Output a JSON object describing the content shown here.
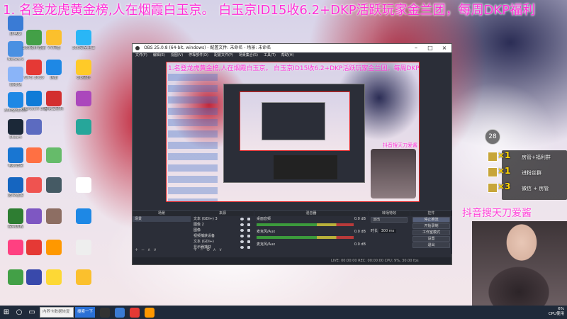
{
  "marquee": "1. 名登龙虎黄金榜,人在烟霞白玉京。 白玉京ID15收6.2+DKP活跃玩家金兰团，每周DKP福利",
  "desktop_icons": [
    {
      "label": "此电脑",
      "color": "#3a7bd5"
    },
    {
      "label": "Network",
      "color": "#4a90e2"
    },
    {
      "label": "回收站",
      "color": "#8ab4f8"
    },
    {
      "label": "360驱动大师",
      "color": "#1e88e5"
    },
    {
      "label": "Steam",
      "color": "#1b2838"
    },
    {
      "label": "电脑管家",
      "color": "#1976d2"
    },
    {
      "label": "宽带连接",
      "color": "#1565c0"
    },
    {
      "label": "控制面板",
      "color": "#2e7d32"
    },
    {
      "label": "360软件管家",
      "color": "#43a047"
    },
    {
      "label": "Microsoft Edge",
      "color": "#0f7bd7"
    },
    {
      "label": "WPS 2019",
      "color": "#e53935"
    },
    {
      "label": "YY开播",
      "color": "#fbc02d"
    },
    {
      "label": "迅雷",
      "color": "#1e88e5"
    },
    {
      "label": "360安全卫士",
      "color": "#29b6f6"
    },
    {
      "label": "网易云音乐",
      "color": "#d32f2f"
    },
    {
      "label": "QQ音乐",
      "color": "#ffca28"
    }
  ],
  "obs": {
    "title": "OBS 25.0.8 (64-bit, windows) - 配置文件: 未命名 - 场景: 未命名",
    "menus": [
      "文件(F)",
      "编辑(E)",
      "视图(V)",
      "停靠部件(D)",
      "配置文件(P)",
      "场景集合(S)",
      "工具(T)",
      "帮助(H)"
    ],
    "preview_text": "1.名登龙虎黄金榜,人在烟霞白玉京。 白玉京ID15收6.2+DKP活跃玩家金兰团，每周DKP福利",
    "preview_label": "抖音搜天刀爱酱",
    "docks": {
      "scenes": {
        "header": "场景",
        "items": [
          "场景"
        ]
      },
      "sources": {
        "header": "来源",
        "items": [
          "文本 (GDI+) 3",
          "图像 2",
          "图像",
          "视频捕获设备",
          "文本 (GDI+)",
          "显示器捕获"
        ]
      },
      "mixer": {
        "header": "混音器",
        "items": [
          "桌面音频",
          "麦克风/Aux",
          "麦克风/Aux"
        ],
        "levels": [
          "0.0 dB",
          "0.0 dB",
          "0.0 dB"
        ]
      },
      "transitions": {
        "header": "转场特效",
        "type": "淡出",
        "duration_label": "时长",
        "duration": "300 ms"
      },
      "controls": {
        "header": "控件",
        "buttons": [
          "停止推流",
          "开始录制",
          "工作室模式",
          "设置",
          "退出"
        ]
      }
    },
    "status": "LIVE: 00:00:00   REC: 00:00:00   CPU: 9%, 30.00 fps"
  },
  "overlay": {
    "prizes": [
      {
        "count": "×1",
        "name": "房管+福利群"
      },
      {
        "count": "×1",
        "name": "进粉丝群"
      },
      {
        "count": "×3",
        "name": "微信 + 房管"
      }
    ],
    "webcam_label": "抖音搜天刀爱酱",
    "cpu_badge": "28"
  },
  "taskbar": {
    "search_placeholder": "内养卡数据恢复",
    "search_button": "搜索一下",
    "tray_line1": "6%",
    "tray_line2": "CPU使用"
  }
}
